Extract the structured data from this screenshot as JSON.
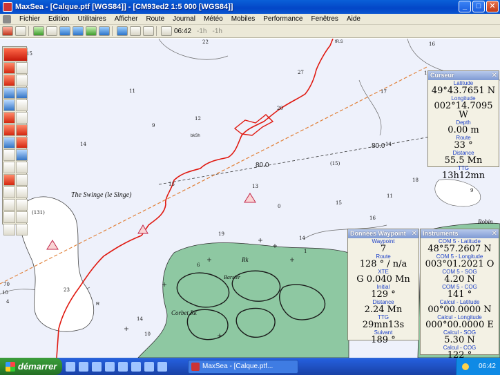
{
  "window": {
    "title": "MaxSea - [Calque.ptf [WGS84]] - [CM93ed2  1:5 000 [WGS84]]",
    "minimize": "_",
    "maximize": "□",
    "close": "✕"
  },
  "menu": [
    {
      "label": "Fichier"
    },
    {
      "label": "Edition"
    },
    {
      "label": "Utilitaires"
    },
    {
      "label": "Afficher"
    },
    {
      "label": "Route"
    },
    {
      "label": "Journal"
    },
    {
      "label": "Météo"
    },
    {
      "label": "Mobiles"
    },
    {
      "label": "Performance"
    },
    {
      "label": "Fenêtres"
    },
    {
      "label": "Aide"
    }
  ],
  "toolbar": {
    "time": "06:42",
    "offset_1": "-1h",
    "offset_2": "-1h"
  },
  "chart": {
    "labels": {
      "swinge": "The Swinge (le Singe)",
      "bkSh": "bkSh",
      "rk": "Rk",
      "barsier": "Barsier",
      "corbet": "Corbet Rk",
      "rk2": "fR.S",
      "r": "R",
      "robin": "Robin",
      "contour_80a": "80.0",
      "contour_80b": "80.0"
    },
    "soundings": [
      {
        "t": "15"
      },
      {
        "t": "22"
      },
      {
        "t": "27"
      },
      {
        "t": "16"
      },
      {
        "t": "11"
      },
      {
        "t": "17"
      },
      {
        "t": "12"
      },
      {
        "t": "14"
      },
      {
        "t": "18"
      },
      {
        "t": "13"
      },
      {
        "t": "19"
      },
      {
        "t": "16"
      },
      {
        "t": "14"
      },
      {
        "t": "15"
      },
      {
        "t": "15"
      },
      {
        "t": "14"
      },
      {
        "t": "9"
      },
      {
        "t": "16"
      },
      {
        "t": "6"
      },
      {
        "t": "10"
      },
      {
        "t": "14"
      },
      {
        "t": "23"
      },
      {
        "t": "(15)"
      },
      {
        "t": "(131)"
      },
      {
        "t": "70"
      },
      {
        "t": "4"
      },
      {
        "t": "9"
      },
      {
        "t": "20"
      },
      {
        "t": "10"
      },
      {
        "t": "10"
      },
      {
        "t": "10"
      },
      {
        "t": "20"
      },
      {
        "t": "11"
      },
      {
        "t": "0"
      },
      {
        "t": "1"
      }
    ]
  },
  "panels": {
    "curseur": {
      "title": "Curseur",
      "fields": [
        {
          "label": "Latitude",
          "value": "49°43.7651 N"
        },
        {
          "label": "Longitude",
          "value": "002°14.7095 W"
        },
        {
          "label": "Depth",
          "value": "0.00 m"
        },
        {
          "label": "Route",
          "value": "33 °"
        },
        {
          "label": "Distance",
          "value": "55.5 Mn"
        },
        {
          "label": "TTG",
          "value": "13h12mn"
        }
      ]
    },
    "waypoint": {
      "title": "Données Waypoint",
      "fields": [
        {
          "label": "Waypoint",
          "value": "7"
        },
        {
          "label": "Route",
          "value": "128 ° / n/a"
        },
        {
          "label": "XTE",
          "value": "G 0.040 Mn"
        },
        {
          "label": "Initial",
          "value": "129 °"
        },
        {
          "label": "Distance",
          "value": "2.24 Mn"
        },
        {
          "label": "TTG",
          "value": "29mn13s"
        },
        {
          "label": "Suivant",
          "value": "189 °"
        }
      ]
    },
    "instruments": {
      "title": "Instruments",
      "fields": [
        {
          "label": "COM 5 - Latitude",
          "value": "48°57.2607 N"
        },
        {
          "label": "COM 5 - Longitude",
          "value": "003°01.2021 O"
        },
        {
          "label": "COM 5 - SOG",
          "value": "4.20 N"
        },
        {
          "label": "COM 5 - COG",
          "value": "141 °"
        },
        {
          "label": "Calcul - Latitude",
          "value": "00°00.0000 N"
        },
        {
          "label": "Calcul - Longitude",
          "value": "000°00.0000 E"
        },
        {
          "label": "Calcul - SOG",
          "value": "5.30 N"
        },
        {
          "label": "Calcul - COG",
          "value": "122 °"
        }
      ]
    }
  },
  "taskbar": {
    "start": "démarrer",
    "task": "MaxSea - [Calque.ptf...",
    "clock": "06:42"
  }
}
